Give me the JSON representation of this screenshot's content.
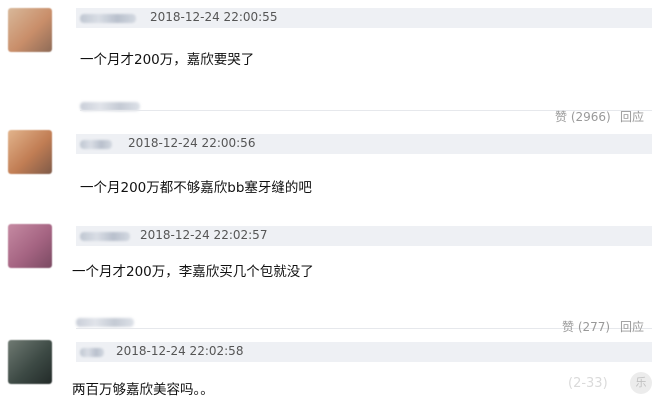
{
  "comments": [
    {
      "timestamp": "2018-12-24 22:00:55",
      "text": "一个月才200万，嘉欣要哭了",
      "avatar_colors": [
        "#d8b89a",
        "#c98e6a",
        "#8e6b57"
      ],
      "like_label": "赞 (2966)",
      "reply_label": "回应"
    },
    {
      "timestamp": "2018-12-24 22:00:56",
      "text": "一个月200万都不够嘉欣bb塞牙缝的吧",
      "avatar_colors": [
        "#e2b48c",
        "#c17d54",
        "#7f5a48"
      ]
    },
    {
      "timestamp": "2018-12-24 22:02:57",
      "text": "一个月才200万，李嘉欣买几个包就没了",
      "avatar_colors": [
        "#c58aa2",
        "#a56482",
        "#7a4a62"
      ],
      "like_label": "赞 (277)",
      "reply_label": "回应"
    },
    {
      "timestamp": "2018-12-24 22:02:58",
      "text": "两百万够嘉欣美容吗。。",
      "avatar_colors": [
        "#6f7a72",
        "#3d4a45",
        "#222a28"
      ]
    }
  ],
  "watermark": "(2-33)"
}
